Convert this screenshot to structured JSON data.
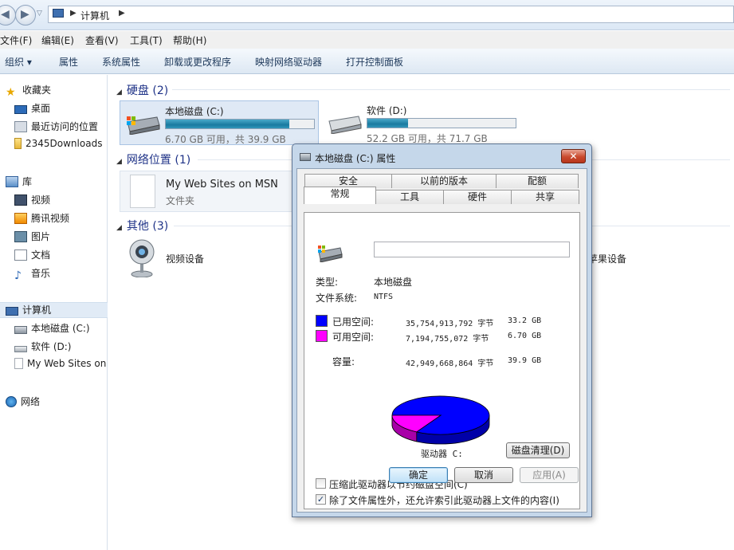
{
  "address": {
    "crumb": "计算机"
  },
  "menu": [
    "文件(F)",
    "编辑(E)",
    "查看(V)",
    "工具(T)",
    "帮助(H)"
  ],
  "toolbar": [
    "组织 ▾",
    "属性",
    "系统属性",
    "卸载或更改程序",
    "映射网络驱动器",
    "打开控制面板"
  ],
  "sidebar": {
    "favorites": {
      "label": "收藏夹",
      "items": [
        "桌面",
        "最近访问的位置",
        "2345Downloads"
      ]
    },
    "libraries": {
      "label": "库",
      "items": [
        "视频",
        "腾讯视频",
        "图片",
        "文档",
        "音乐"
      ]
    },
    "computer": {
      "label": "计算机",
      "items": [
        "本地磁盘 (C:)",
        "软件 (D:)",
        "My Web Sites on MSN"
      ]
    },
    "network": {
      "label": "网络"
    }
  },
  "groups": {
    "hdd": "硬盘 (2)",
    "netloc": "网络位置 (1)",
    "other": "其他 (3)"
  },
  "drives": [
    {
      "name": "本地磁盘 (C:)",
      "free_text": "6.70 GB 可用，共 39.9 GB",
      "used_fraction": 0.832
    },
    {
      "name": "软件 (D:)",
      "free_text": "52.2 GB 可用，共 71.7 GB",
      "used_fraction": 0.272
    }
  ],
  "network_location": {
    "title": "My Web Sites on MSN",
    "type": "文件夹"
  },
  "other_devices": {
    "webcam": "视频设备",
    "apple": "苹果设备"
  },
  "dialog": {
    "title": "本地磁盘 (C:) 属性",
    "close": "✕",
    "tabs_row1": [
      "安全",
      "以前的版本",
      "配额"
    ],
    "tabs_row2": [
      "常规",
      "工具",
      "硬件",
      "共享"
    ],
    "name_value": "",
    "type_label": "类型:",
    "type_value": "本地磁盘",
    "fs_label": "文件系统:",
    "fs_value": "NTFS",
    "used_label": "已用空间:",
    "used_bytes": "35,754,913,792 字节",
    "used_gb": "33.2 GB",
    "free_label": "可用空间:",
    "free_bytes": "7,194,755,072 字节",
    "free_gb": "6.70 GB",
    "cap_label": "容量:",
    "cap_bytes": "42,949,668,864 字节",
    "cap_gb": "39.9 GB",
    "drive_label": "驱动器 C:",
    "cleanup": "磁盘清理(D)",
    "compress": "压缩此驱动器以节约磁盘空间(C)",
    "index": "除了文件属性外，还允许索引此驱动器上文件的内容(I)",
    "index_checked": "✓",
    "ok": "确定",
    "cancel": "取消",
    "apply": "应用(A)",
    "used_color": "#0000ff",
    "free_color": "#ff00ff"
  }
}
